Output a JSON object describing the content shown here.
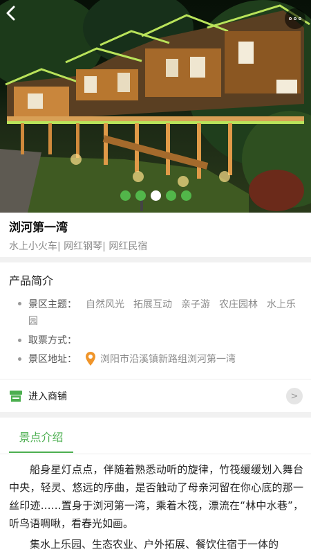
{
  "hero": {
    "slide_count": 5,
    "active_slide": 3,
    "accent_color": "#52b64a"
  },
  "product": {
    "title": "浏河第一湾",
    "tags": "水上小火车| 网红钢琴| 网红民宿"
  },
  "intro": {
    "section_title": "产品简介",
    "theme_label": "景区主题：",
    "themes": [
      "自然风光",
      "拓展互动",
      "亲子游",
      "农庄园林",
      "水上乐园"
    ],
    "ticket_label": "取票方式：",
    "ticket_value": "",
    "address_label": "景区地址：",
    "address_value": "浏阳市沿溪镇新路组浏河第一湾",
    "pin_color": "#f0952a"
  },
  "shop": {
    "label": "进入商铺",
    "arrow": ">",
    "icon_color": "#4caf50"
  },
  "tabs": {
    "active_label": "景点介绍"
  },
  "article": {
    "p1": "船身星灯点点，伴随着熟悉动听的旋律，竹筏缓缓划入舞台中央，轻灵、悠远的序曲，是否触动了母亲河留在你心底的那一丝印迹……置身于浏河第一湾，乘着木筏，漂流在“林中水巷”，听鸟语啁啾，看春光如画。",
    "p2": "集水上乐园、生态农业、户外拓展、餐饮住宿于一体的"
  }
}
